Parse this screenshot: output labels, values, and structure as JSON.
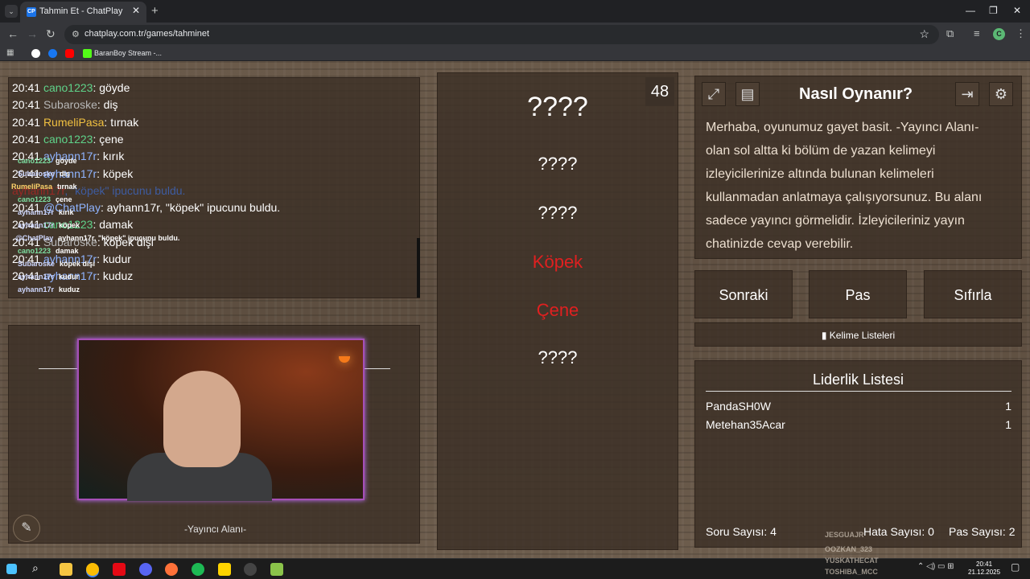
{
  "browser": {
    "tab_title": "Tahmin Et - ChatPlay",
    "tab_favicon": "CP",
    "url": "chatplay.com.tr/games/tahminet",
    "bookmark_label": "BaranBoy Stream -...",
    "profile_initial": "C"
  },
  "chat": {
    "lines": [
      {
        "time": "20:41",
        "user": "cano1223",
        "text": ": göyde"
      },
      {
        "time": "20:41",
        "user": "Subaroske",
        "text": ": diş"
      },
      {
        "time": "20:41",
        "user": "RumeliPasa",
        "text": ": tırnak"
      },
      {
        "time": "20:41",
        "user": "cano1223",
        "text": ": çene"
      },
      {
        "time": "20:41",
        "user": "ayhann17r",
        "text": ": kırık"
      },
      {
        "time": "20:41",
        "user": "ayhann17r",
        "text": ": köpek"
      },
      {
        "time": "",
        "user": "ayhann17r",
        "text": ", \"köpek\" ipucunu buldu."
      },
      {
        "time": "20:41",
        "user": "@ChatPlay",
        "text": ": ayhann17r, \"köpek\" ipucunu buldu."
      },
      {
        "time": "20:41",
        "user": "cano1223",
        "text": ": damak"
      },
      {
        "time": "20:41",
        "user": "Subaroske",
        "text": ": köpek dişi"
      },
      {
        "time": "20:41",
        "user": "ayhann17r",
        "text": ": kudur"
      },
      {
        "time": "20:41",
        "user": "ayhann17r",
        "text": ": kuduz"
      }
    ],
    "overlay": [
      {
        "user": "cano1223",
        "text": "göyde"
      },
      {
        "user": "Subaroske",
        "text": "diş"
      },
      {
        "user": "RumeliPasa",
        "text": "tırnak"
      },
      {
        "user": "cano1223",
        "text": "çene"
      },
      {
        "user": "ayhann17r",
        "text": "kırık"
      },
      {
        "user": "ayhann17r",
        "text": "köpek"
      },
      {
        "user": "@ChatPlay",
        "text": "ayhann17r, \"köpek\" ipucunu buldu."
      },
      {
        "user": "cano1223",
        "text": "damak"
      },
      {
        "user": "Subaroske",
        "text": "köpek dişi"
      },
      {
        "user": "ayhann17r",
        "text": "kudur"
      },
      {
        "user": "ayhann17r",
        "text": "kuduz"
      }
    ]
  },
  "streamer": {
    "label": "-Yayıncı Alanı-"
  },
  "words": {
    "counter": "48",
    "items": [
      "????",
      "????",
      "????",
      "Köpek",
      "Çene",
      "????"
    ]
  },
  "howto": {
    "title": "Nasıl Oynanır?",
    "text": "Merhaba, oyunumuz gayet basit. -Yayıncı Alanı- olan sol altta ki bölüm de yazan kelimeyi izleyicilerinize altında bulunan kelimeleri kullanmadan anlatmaya çalışıyorsunuz. Bu alanı sadece yayıncı görmelidir. İzleyicileriniz yayın chatinizde cevap verebilir."
  },
  "controls": {
    "next": "Sonraki",
    "pass": "Pas",
    "reset": "Sıfırla",
    "word_lists": "Kelime Listeleri"
  },
  "leaderboard": {
    "title": "Liderlik Listesi",
    "rows": [
      {
        "name": "PandaSH0W",
        "score": "1"
      },
      {
        "name": "Metehan35Acar",
        "score": "1"
      }
    ]
  },
  "stats": {
    "questions": "Soru Sayısı: 4",
    "errors": "Hata Sayısı: 0",
    "passes": "Pas Sayısı: 2"
  },
  "ghost_names": [
    "JESGUAJR",
    "OOZKAN_323",
    "YUSKATHECAT",
    "TOSHIBA_MCC"
  ],
  "taskbar": {
    "time": "20:41",
    "date": "21.12.2025"
  }
}
